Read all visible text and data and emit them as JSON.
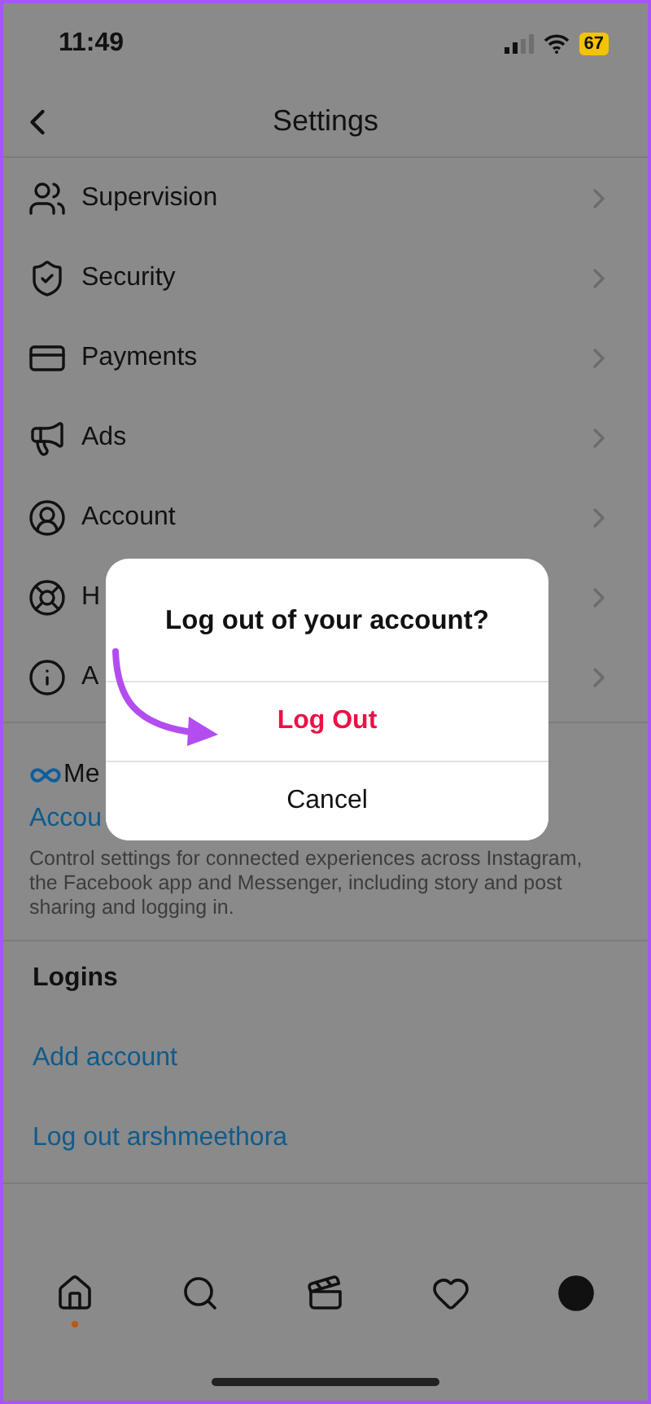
{
  "status_bar": {
    "time": "11:49",
    "battery": "67",
    "low_power": true
  },
  "header": {
    "title": "Settings"
  },
  "menu": [
    {
      "label": "Supervision"
    },
    {
      "label": "Security"
    },
    {
      "label": "Payments"
    },
    {
      "label": "Ads"
    },
    {
      "label": "Account"
    },
    {
      "label": "H"
    },
    {
      "label": "A"
    }
  ],
  "meta": {
    "brand": "Me",
    "link": "Accou",
    "description": "Control settings for connected experiences across Instagram, the Facebook app and Messenger, including story and post sharing and logging in."
  },
  "logins": {
    "heading": "Logins",
    "links": [
      "Add account",
      "Log out arshmeethora"
    ]
  },
  "dialog": {
    "title": "Log out of your account?",
    "actions": [
      {
        "label": "Log Out",
        "kind": "destructive"
      },
      {
        "label": "Cancel",
        "kind": "default"
      }
    ]
  },
  "tab_bar": [
    {
      "notification": true
    },
    {
      "notification": false
    },
    {
      "notification": false
    },
    {
      "notification": false
    },
    {
      "notification": false
    }
  ]
}
